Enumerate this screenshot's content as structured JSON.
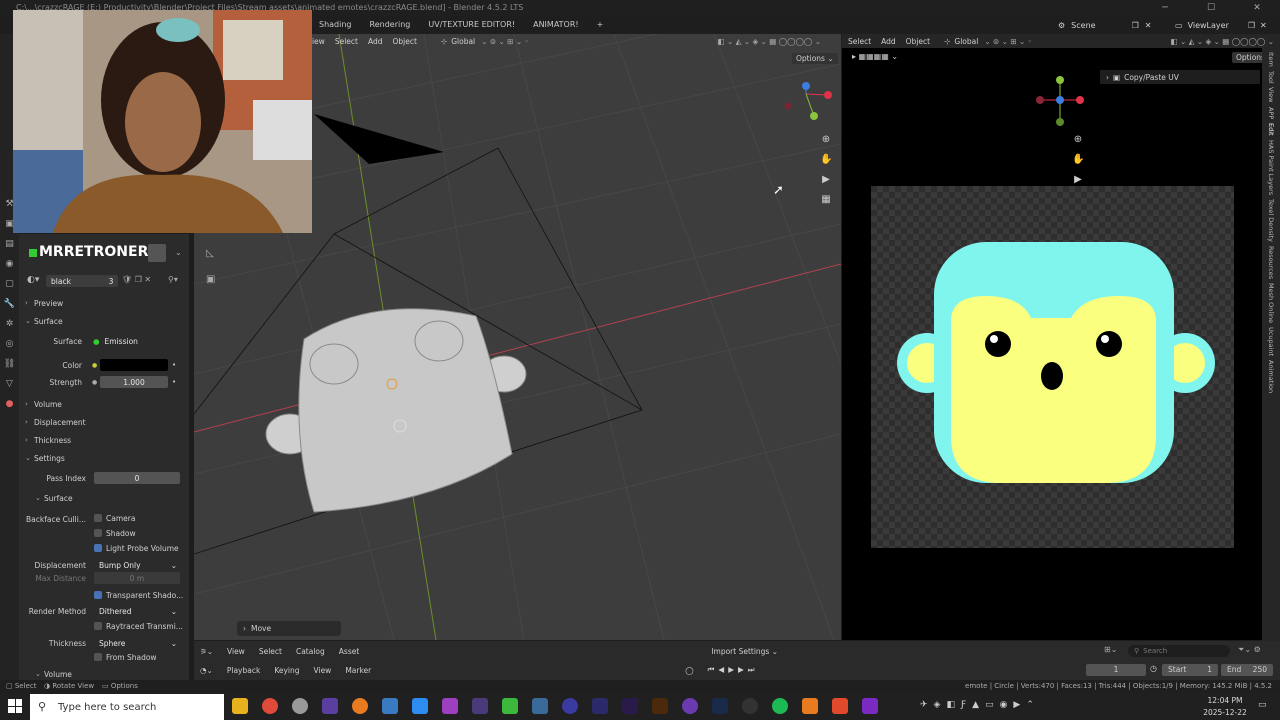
{
  "window": {
    "title": "C:\\...\\crazzcRAGE (E:) Productivity\\Blender\\Project Files\\Stream assets\\animated emotes\\crazzcRAGE.blend] - Blender 4.5.2 LTS"
  },
  "topbar": {
    "workspaces": [
      "Shading",
      "Rendering",
      "UV/TEXTURE EDITOR!",
      "ANIMATOR!",
      "+"
    ],
    "scene": "Scene",
    "view_layer": "ViewLayer"
  },
  "viewport_header": {
    "menus": [
      "View",
      "Select",
      "Add",
      "Object"
    ],
    "orientation": "Global",
    "options": "Options"
  },
  "uv_header": {
    "menus": [
      "Select",
      "Add",
      "Object"
    ],
    "orientation": "Global",
    "options": "Options",
    "panel": "Copy/Paste UV"
  },
  "uv_tabs": [
    "Item",
    "Tool",
    "View",
    "APP",
    "Edit",
    "HAS Paint Layers",
    "Texel Density",
    "Resources",
    "Mesh Online",
    "Ucupaint",
    "Animation"
  ],
  "material": {
    "owner": "MRRETRONERO:",
    "name": "black",
    "users": "3",
    "sections": {
      "preview": "Preview",
      "surface": "Surface",
      "volume": "Volume",
      "displacement": "Displacement",
      "thickness": "Thickness",
      "settings": "Settings",
      "sub_surface": "Surface",
      "volume2": "Volume"
    },
    "surface_label": "Surface",
    "surface_value": "Emission",
    "color_label": "Color",
    "strength_label": "Strength",
    "strength_value": "1.000",
    "pass_index_label": "Pass Index",
    "pass_index_value": "0",
    "backface_label": "Backface Culli...",
    "camera_label": "Camera",
    "shadow_label": "Shadow",
    "light_probe_label": "Light Probe Volume",
    "displacement_label": "Displacement",
    "displacement_value": "Bump Only",
    "max_distance_label": "Max Distance",
    "max_distance_value": "0 m",
    "transparent_shadows_label": "Transparent Shado...",
    "render_method_label": "Render Method",
    "render_method_value": "Dithered",
    "raytraced_label": "Raytraced Transmi...",
    "thickness_label": "Thickness",
    "thickness_value": "Sphere",
    "from_shadow_label": "From Shadow"
  },
  "operator_panel": "Move",
  "timeline": {
    "menus": [
      "Playback",
      "Keying",
      "View",
      "Marker"
    ],
    "top_menus": [
      "View",
      "Select",
      "Catalog",
      "Asset"
    ],
    "import_settings": "Import Settings",
    "search_placeholder": "Search",
    "frame": "1",
    "start_label": "Start",
    "start": "1",
    "end_label": "End",
    "end": "250"
  },
  "statusbar": {
    "left": [
      "Select",
      "Rotate View",
      "Options"
    ],
    "right": "emote | Circle | Verts:470 | Faces:13 | Tris:444 | Objects:1/9 | Memory: 145.2 MiB | 4.5.2"
  },
  "taskbar": {
    "search_placeholder": "Type here to search",
    "time": "12:04 PM",
    "date": "2025-12-22"
  },
  "colors": {
    "accent": "#4772b3",
    "monkey_face_outer": "#7ff5ee",
    "monkey_face_inner": "#fbff7f",
    "x_axis": "#e0334a",
    "y_axis": "#8bc43c",
    "z_axis": "#3c7fe0"
  }
}
